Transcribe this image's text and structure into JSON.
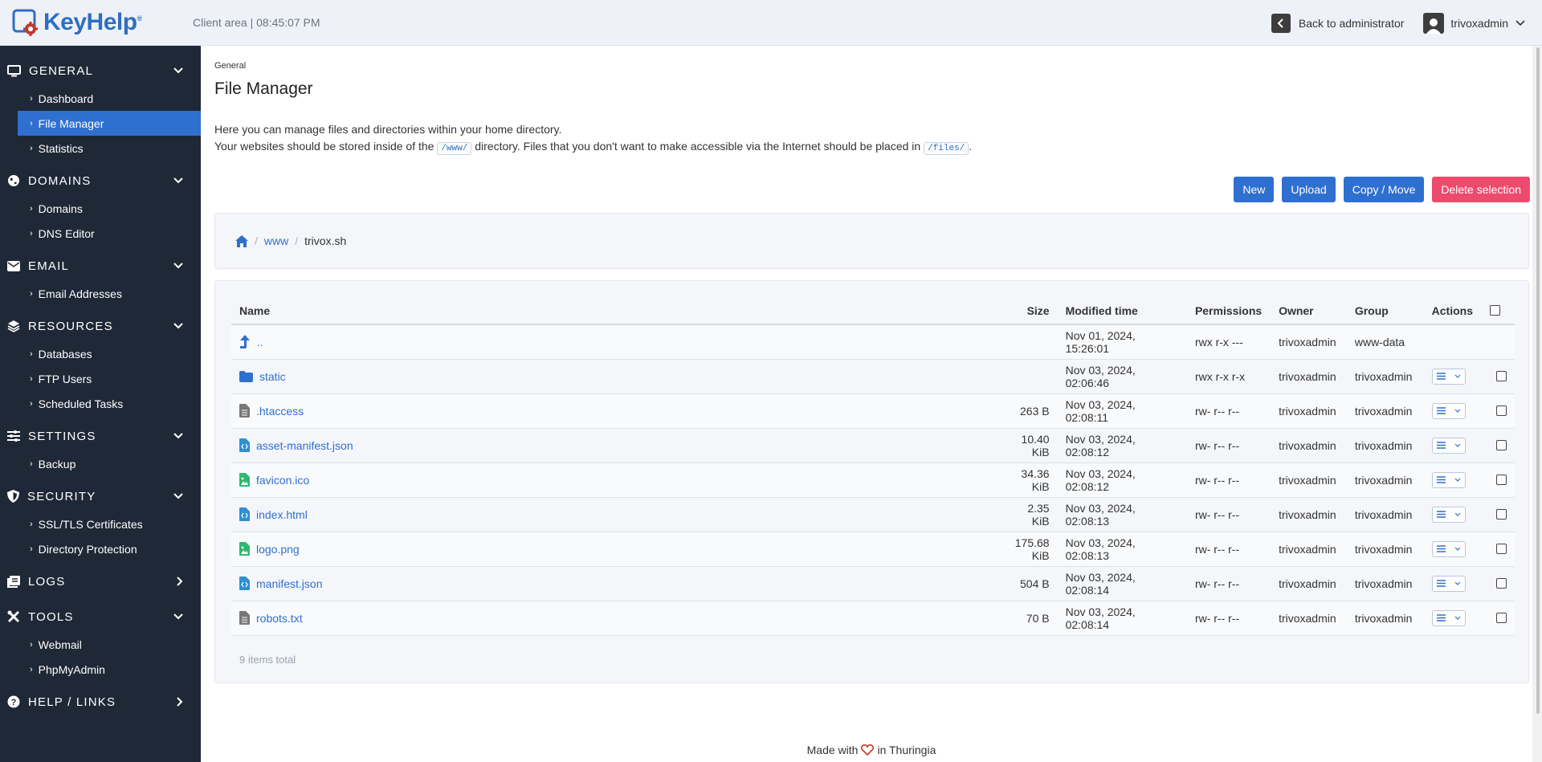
{
  "header": {
    "brand": "KeyHelp",
    "client_area": "Client area | 08:45:07 PM",
    "back_label": "Back to administrator",
    "username": "trivoxadmin"
  },
  "sidebar": {
    "sections": [
      {
        "title": "GENERAL",
        "icon": "monitor-icon",
        "items": [
          "Dashboard",
          "File Manager",
          "Statistics"
        ]
      },
      {
        "title": "DOMAINS",
        "icon": "globe-icon",
        "items": [
          "Domains",
          "DNS Editor"
        ]
      },
      {
        "title": "EMAIL",
        "icon": "envelope-icon",
        "items": [
          "Email Addresses"
        ]
      },
      {
        "title": "RESOURCES",
        "icon": "layers-icon",
        "items": [
          "Databases",
          "FTP Users",
          "Scheduled Tasks"
        ]
      },
      {
        "title": "SETTINGS",
        "icon": "sliders-icon",
        "items": [
          "Backup"
        ]
      },
      {
        "title": "SECURITY",
        "icon": "shield-icon",
        "items": [
          "SSL/TLS Certificates",
          "Directory Protection"
        ]
      },
      {
        "title": "LOGS",
        "icon": "logs-icon",
        "items": []
      },
      {
        "title": "TOOLS",
        "icon": "tools-icon",
        "items": [
          "Webmail",
          "PhpMyAdmin"
        ]
      },
      {
        "title": "HELP / LINKS",
        "icon": "help-icon",
        "items": []
      }
    ],
    "active_item": "File Manager"
  },
  "page": {
    "breadcrumb_small": "General",
    "title": "File Manager",
    "desc_line1": "Here you can manage files and directories within your home directory.",
    "desc_line2_a": "Your websites should be stored inside of the",
    "code_www": "/www/",
    "desc_line2_b": "directory. Files that you don't want to make accessible via the Internet should be placed in",
    "code_files": "/files/",
    "desc_line2_c": "."
  },
  "buttons": {
    "new": "New",
    "upload": "Upload",
    "copy_move": "Copy / Move",
    "delete": "Delete selection"
  },
  "path": {
    "segment1": "www",
    "separator": "/",
    "current": "trivox.sh"
  },
  "table": {
    "headers": {
      "name": "Name",
      "size": "Size",
      "modified": "Modified time",
      "permissions": "Permissions",
      "owner": "Owner",
      "group": "Group",
      "actions": "Actions"
    },
    "rows": [
      {
        "name": "..",
        "size": "",
        "modified": "Nov 01, 2024, 15:26:01",
        "permissions": "rwx r-x ---",
        "owner": "trivoxadmin",
        "group": "www-data"
      },
      {
        "name": "static",
        "size": "",
        "modified": "Nov 03, 2024, 02:06:46",
        "permissions": "rwx r-x r-x",
        "owner": "trivoxadmin",
        "group": "trivoxadmin"
      },
      {
        "name": ".htaccess",
        "size": "263 B",
        "modified": "Nov 03, 2024, 02:08:11",
        "permissions": "rw- r-- r--",
        "owner": "trivoxadmin",
        "group": "trivoxadmin"
      },
      {
        "name": "asset-manifest.json",
        "size": "10.40 KiB",
        "modified": "Nov 03, 2024, 02:08:12",
        "permissions": "rw- r-- r--",
        "owner": "trivoxadmin",
        "group": "trivoxadmin"
      },
      {
        "name": "favicon.ico",
        "size": "34.36 KiB",
        "modified": "Nov 03, 2024, 02:08:12",
        "permissions": "rw- r-- r--",
        "owner": "trivoxadmin",
        "group": "trivoxadmin"
      },
      {
        "name": "index.html",
        "size": "2.35 KiB",
        "modified": "Nov 03, 2024, 02:08:13",
        "permissions": "rw- r-- r--",
        "owner": "trivoxadmin",
        "group": "trivoxadmin"
      },
      {
        "name": "logo.png",
        "size": "175.68 KiB",
        "modified": "Nov 03, 2024, 02:08:13",
        "permissions": "rw- r-- r--",
        "owner": "trivoxadmin",
        "group": "trivoxadmin"
      },
      {
        "name": "manifest.json",
        "size": "504 B",
        "modified": "Nov 03, 2024, 02:08:14",
        "permissions": "rw- r-- r--",
        "owner": "trivoxadmin",
        "group": "trivoxadmin"
      },
      {
        "name": "robots.txt",
        "size": "70 B",
        "modified": "Nov 03, 2024, 02:08:14",
        "permissions": "rw- r-- r--",
        "owner": "trivoxadmin",
        "group": "trivoxadmin"
      }
    ],
    "total": "9 items total"
  },
  "footer": {
    "made_with": "Made with",
    "in_place": "in Thuringia"
  },
  "colors": {
    "sidebar_bg": "#1f2836",
    "accent": "#2f6fd0",
    "danger": "#ee4a6e",
    "icon_green": "#2eb872"
  }
}
